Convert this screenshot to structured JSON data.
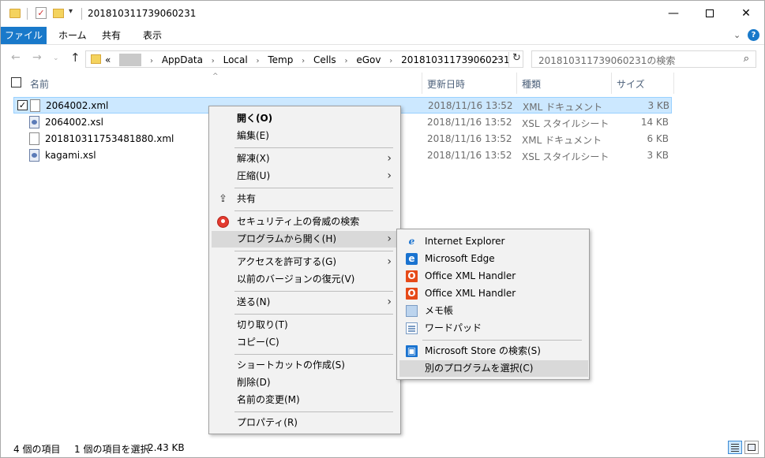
{
  "window": {
    "title": "201810311739060231",
    "minimize": "—",
    "maximize": "",
    "close": "✕"
  },
  "ribbon": {
    "tabs": [
      "ファイル",
      "ホーム",
      "共有",
      "表示"
    ],
    "collapse": "⌄",
    "help": "?"
  },
  "nav": {
    "back": "←",
    "forward": "→",
    "recent": "⌄",
    "up": "↑",
    "prefix": "«",
    "crumbs": [
      "AppData",
      "Local",
      "Temp",
      "Cells",
      "eGov",
      "201810311739060231"
    ],
    "separator": "›",
    "dropdown": "⌄",
    "refresh": "↻"
  },
  "search": {
    "placeholder": "201810311739060231の検索",
    "icon": "⌕"
  },
  "columns": {
    "name": "名前",
    "date": "更新日時",
    "type": "種類",
    "size": "サイズ",
    "sort_arrow": "^"
  },
  "files": [
    {
      "name": "2064002.xml",
      "date": "2018/11/16 13:52",
      "type": "XML ドキュメント",
      "size": "3 KB",
      "kind": "xml",
      "selected": true,
      "check": "✓"
    },
    {
      "name": "2064002.xsl",
      "date": "2018/11/16 13:52",
      "type": "XSL スタイルシート",
      "size": "14 KB",
      "kind": "xsl",
      "selected": false
    },
    {
      "name": "20181031175348188​0.xml",
      "date": "2018/11/16 13:52",
      "type": "XML ドキュメント",
      "size": "6 KB",
      "kind": "xml",
      "selected": false
    },
    {
      "name": "kagami.xsl",
      "date": "2018/11/16 13:52",
      "type": "XSL スタイルシート",
      "size": "3 KB",
      "kind": "xsl",
      "selected": false
    }
  ],
  "context_menu": {
    "open": "開く(O)",
    "edit": "編集(E)",
    "extract": "解凍(X)",
    "compress": "圧縮(U)",
    "share": "共有",
    "security_scan": "セキュリティ上の脅威の検索",
    "open_with": "プログラムから開く(H)",
    "give_access": "アクセスを許可する(G)",
    "restore_versions": "以前のバージョンの復元(V)",
    "send_to": "送る(N)",
    "cut": "切り取り(T)",
    "copy": "コピー(C)",
    "create_shortcut": "ショートカットの作成(S)",
    "delete": "削除(D)",
    "rename": "名前の変更(M)",
    "properties": "プロパティ(R)",
    "submenu_arrow": "›",
    "share_glyph": "⇪"
  },
  "open_with_menu": {
    "items": [
      {
        "label": "Internet Explorer",
        "icon": "internet-explorer-icon",
        "glyph": "e"
      },
      {
        "label": "Microsoft Edge",
        "icon": "edge-icon",
        "glyph": "e"
      },
      {
        "label": "Office XML Handler",
        "icon": "office-icon",
        "glyph": "O"
      },
      {
        "label": "Office XML Handler",
        "icon": "office-icon",
        "glyph": "O"
      },
      {
        "label": "メモ帳",
        "icon": "notepad-icon",
        "glyph": ""
      },
      {
        "label": "ワードパッド",
        "icon": "wordpad-icon",
        "glyph": ""
      }
    ],
    "store": "Microsoft Store の検索(S)",
    "store_glyph": "▣",
    "choose_other": "別のプログラムを選択(C)"
  },
  "status": {
    "item_count": "4 個の項目",
    "selected": "1 個の項目を選択",
    "selected_size": "2.43 KB"
  },
  "colors": {
    "accent": "#1979ca",
    "selection": "#cce8ff",
    "menu_bg": "#f2f2f2",
    "menu_highlight": "#d9d9d9"
  }
}
